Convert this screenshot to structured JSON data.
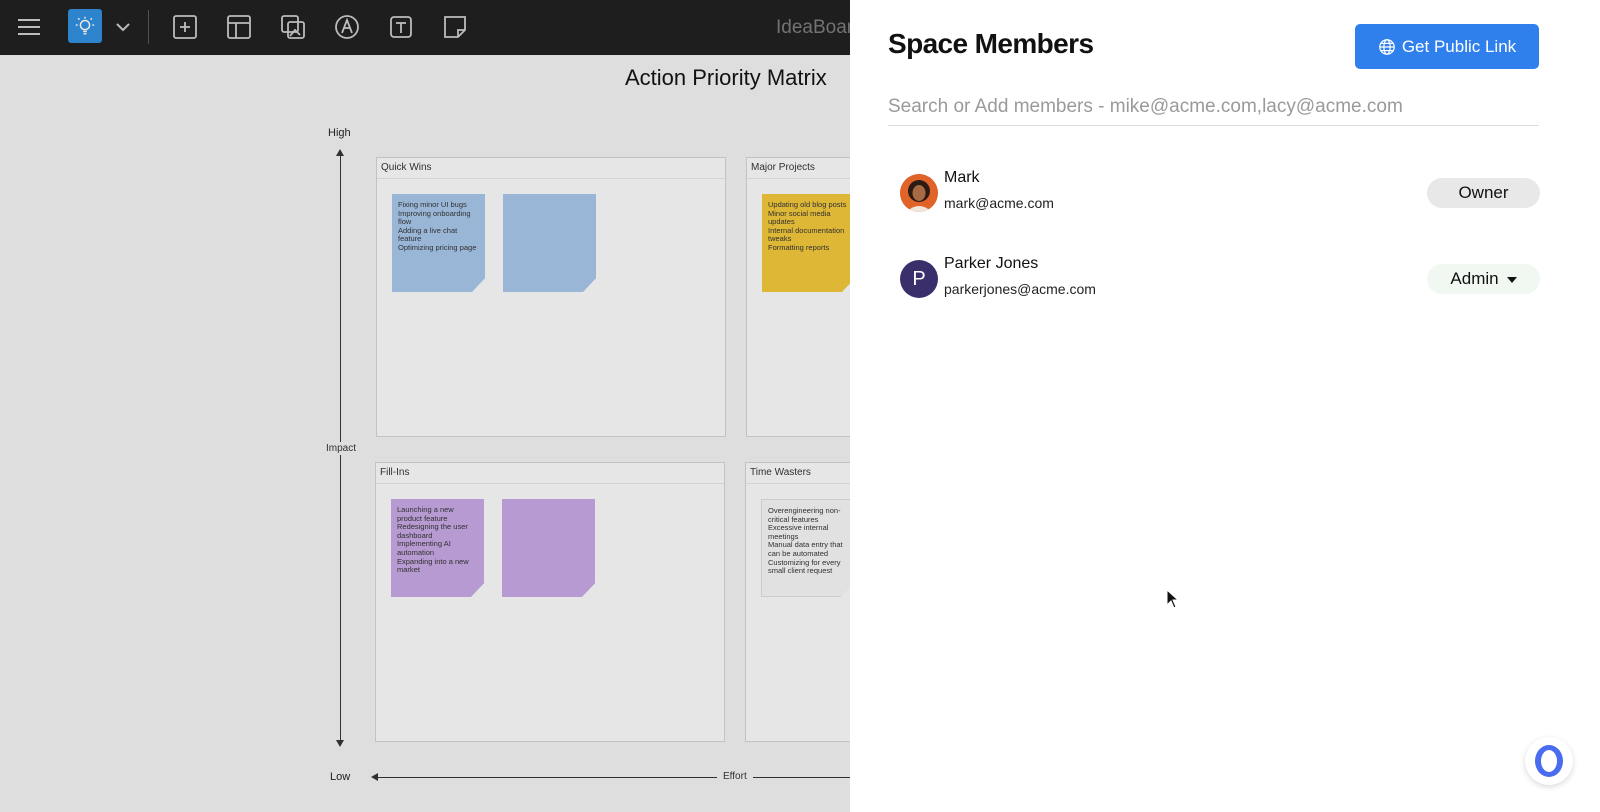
{
  "board": {
    "name": "IdeaBoar",
    "title": "Action Priority Matrix",
    "axis": {
      "high": "High",
      "low": "Low",
      "impact": "Impact",
      "effort": "Effort"
    },
    "quadrants": {
      "quick_wins": {
        "title": "Quick Wins",
        "note_lines": [
          "Fixing minor UI bugs",
          "Improving onboarding flow",
          "Adding a live chat feature",
          "Optimizing pricing page"
        ]
      },
      "major_projects": {
        "title": "Major Projects",
        "note_lines": [
          "Updating old blog posts",
          "Minor social media updates",
          "Internal documentation tweaks",
          "Formatting reports"
        ]
      },
      "fill_ins": {
        "title": "Fill-Ins",
        "note_lines": [
          "Launching a new product feature",
          "Redesigning the user dashboard",
          "Implementing AI automation",
          "Expanding into a new market"
        ]
      },
      "time_wasters": {
        "title": "Time Wasters",
        "note_lines": [
          "Overengineering non-critical features",
          "Excessive internal meetings",
          "Manual data entry that can be automated",
          "Customizing for every small client request"
        ]
      }
    }
  },
  "panel": {
    "title": "Space Members",
    "public_link_label": "Get Public Link",
    "search_placeholder": "Search or Add members - mike@acme.com,lacy@acme.com",
    "members": [
      {
        "name": "Mark",
        "email": "mark@acme.com",
        "role": "Owner"
      },
      {
        "name": "Parker Jones",
        "email": "parkerjones@acme.com",
        "role": "Admin",
        "initial": "P"
      }
    ]
  },
  "colors": {
    "accent": "#2f80ed",
    "toolbar": "#1f1f1f",
    "note_blue": "#a9c8ec",
    "note_yellow": "#f4c93a",
    "note_purple": "#c8a9e6",
    "avatar_purple": "#3b2f6b"
  }
}
